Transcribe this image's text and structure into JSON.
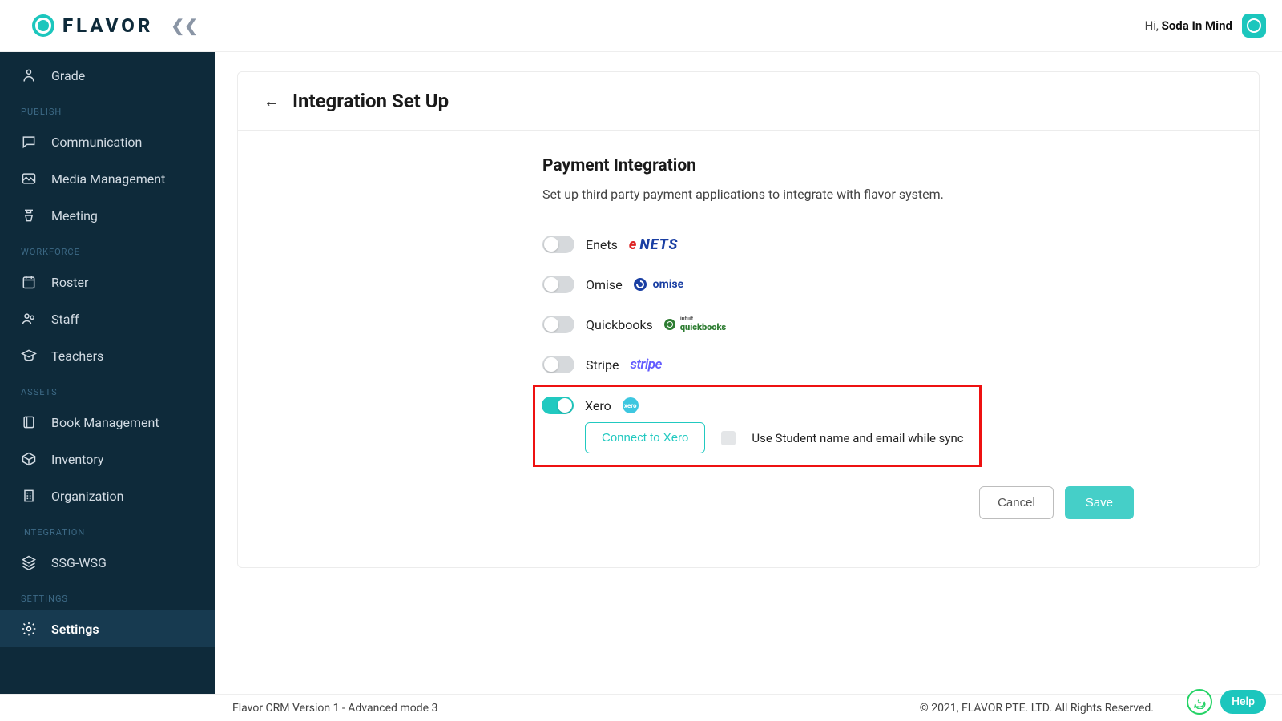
{
  "brand": {
    "name": "FLAVOR"
  },
  "header": {
    "greeting_prefix": "Hi, ",
    "user_name": "Soda In Mind"
  },
  "sidebar": {
    "grade": "Grade",
    "groups": [
      {
        "label": "PUBLISH",
        "items": [
          {
            "key": "communication",
            "label": "Communication"
          },
          {
            "key": "media",
            "label": "Media Management"
          },
          {
            "key": "meeting",
            "label": "Meeting"
          }
        ]
      },
      {
        "label": "WORKFORCE",
        "items": [
          {
            "key": "roster",
            "label": "Roster"
          },
          {
            "key": "staff",
            "label": "Staff"
          },
          {
            "key": "teachers",
            "label": "Teachers"
          }
        ]
      },
      {
        "label": "ASSETS",
        "items": [
          {
            "key": "book",
            "label": "Book Management"
          },
          {
            "key": "inventory",
            "label": "Inventory"
          },
          {
            "key": "organization",
            "label": "Organization"
          }
        ]
      },
      {
        "label": "INTEGRATION",
        "items": [
          {
            "key": "ssgwsg",
            "label": "SSG-WSG"
          }
        ]
      },
      {
        "label": "SETTINGS",
        "items": [
          {
            "key": "settings",
            "label": "Settings",
            "active": true
          }
        ]
      }
    ]
  },
  "page": {
    "title": "Integration Set Up",
    "section_title": "Payment Integration",
    "section_desc": "Set up third party payment applications to integrate with flavor system.",
    "integrations": {
      "enets": {
        "label": "Enets",
        "enabled": false
      },
      "omise": {
        "label": "Omise",
        "enabled": false,
        "logo_text": "omise"
      },
      "quickbooks": {
        "label": "Quickbooks",
        "enabled": false,
        "logo_top": "intuit",
        "logo_text": "quickbooks"
      },
      "stripe": {
        "label": "Stripe",
        "enabled": false,
        "logo_text": "stripe"
      },
      "xero": {
        "label": "Xero",
        "enabled": true,
        "logo_text": "xero",
        "connect_button": "Connect to Xero",
        "checkbox_label": "Use Student name and email while sync",
        "checkbox_checked": false
      }
    },
    "cancel": "Cancel",
    "save": "Save"
  },
  "footer": {
    "version": "Flavor CRM Version 1 - Advanced mode 3",
    "copyright": "© 2021, FLAVOR PTE. LTD. All Rights Reserved."
  },
  "help_label": "Help",
  "colors": {
    "accent": "#1cc6bd",
    "sidebar": "#0e2a3a",
    "highlight_box": "#e11"
  }
}
